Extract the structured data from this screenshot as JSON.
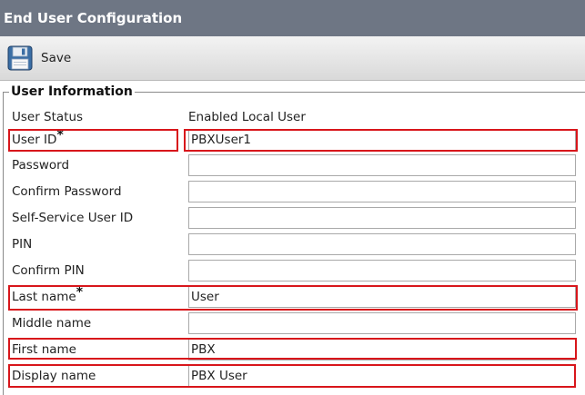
{
  "window": {
    "title": "End User Configuration"
  },
  "toolbar": {
    "save_label": "Save",
    "save_icon": "floppy-disk-icon"
  },
  "section": {
    "legend": "User Information"
  },
  "fields": {
    "user_status": {
      "label": "User Status",
      "value": "Enabled Local User"
    },
    "user_id": {
      "label": "User ID",
      "required": "*",
      "value": "PBXUser1"
    },
    "password": {
      "label": "Password",
      "value": ""
    },
    "confirm_password": {
      "label": "Confirm Password",
      "value": ""
    },
    "self_service_user_id": {
      "label": "Self-Service User ID",
      "value": ""
    },
    "pin": {
      "label": "PIN",
      "value": ""
    },
    "confirm_pin": {
      "label": "Confirm PIN",
      "value": ""
    },
    "last_name": {
      "label": "Last name",
      "required": "*",
      "value": "User"
    },
    "middle_name": {
      "label": "Middle name",
      "value": ""
    },
    "first_name": {
      "label": "First name",
      "value": "PBX"
    },
    "display_name": {
      "label": "Display name",
      "value": "PBX User"
    }
  },
  "colors": {
    "title_bar": "#6e7684",
    "highlight": "#d8161b"
  }
}
